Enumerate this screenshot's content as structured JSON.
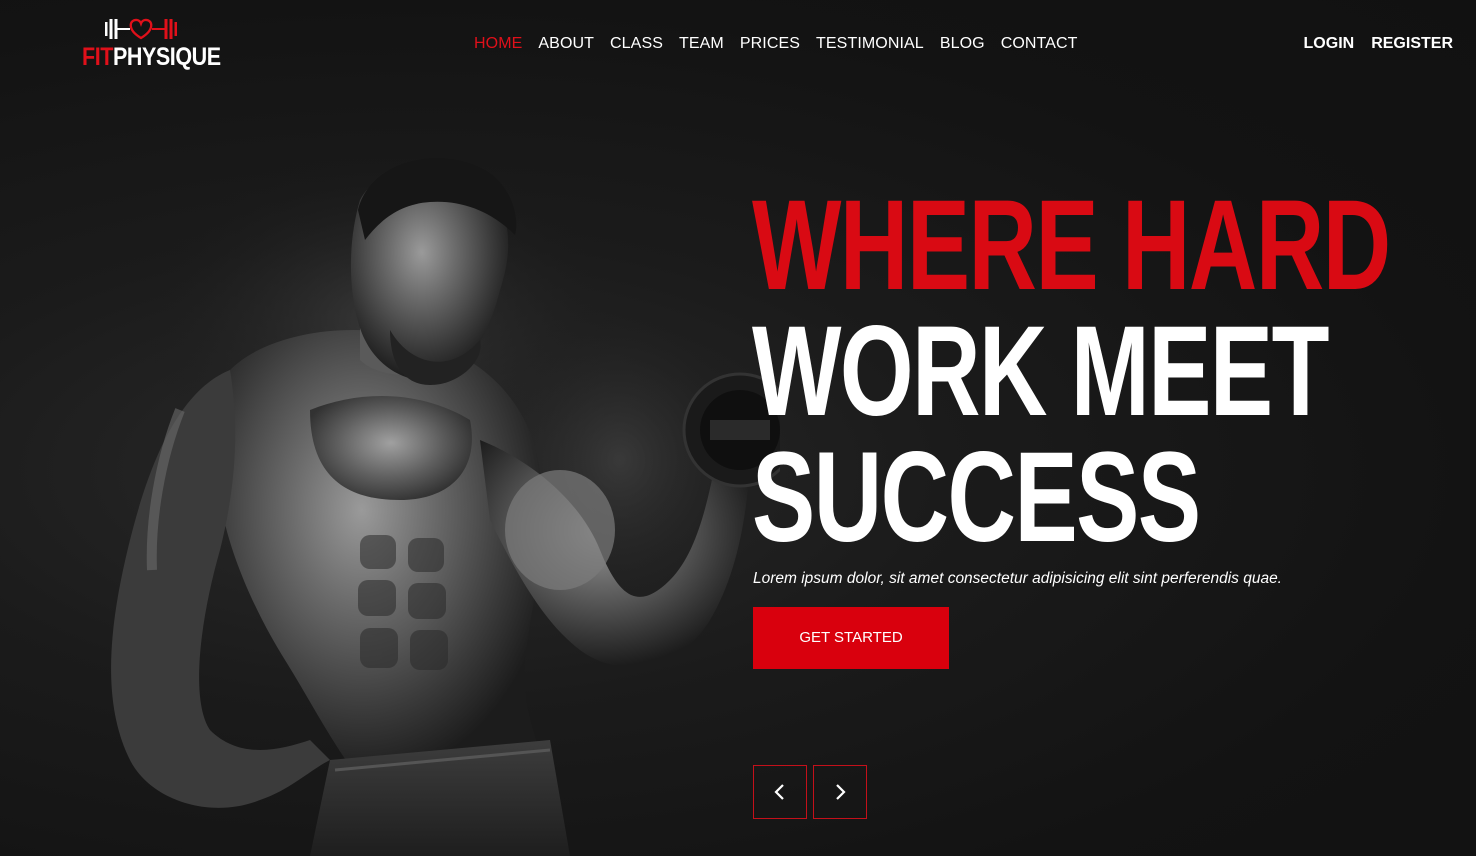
{
  "brand": {
    "name_part1": "FIT",
    "name_part2": "PHYSIQUE",
    "logo_icon": "dumbbell-heart-icon",
    "accent_color": "#e0101a"
  },
  "nav": {
    "items": [
      {
        "label": "HOME",
        "active": true
      },
      {
        "label": "ABOUT",
        "active": false
      },
      {
        "label": "CLASS",
        "active": false
      },
      {
        "label": "TEAM",
        "active": false
      },
      {
        "label": "PRICES",
        "active": false
      },
      {
        "label": "TESTIMONIAL",
        "active": false
      },
      {
        "label": "BLOG",
        "active": false
      },
      {
        "label": "CONTACT",
        "active": false
      }
    ]
  },
  "auth": {
    "login": "LOGIN",
    "register": "REGISTER"
  },
  "hero": {
    "headline_line1": "WHERE HARD",
    "headline_line2": "WORK MEET",
    "headline_line3": "SUCCESS",
    "subtext": "Lorem ipsum dolor, sit amet consectetur adipisicing elit sint perferendis quae.",
    "cta_label": "GET STARTED",
    "image": "bodybuilder-with-dumbbell-photo",
    "prev_icon": "chevron-left-icon",
    "next_icon": "chevron-right-icon"
  }
}
